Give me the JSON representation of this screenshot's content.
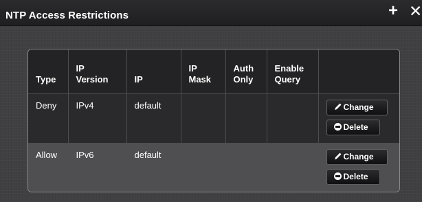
{
  "header": {
    "title": "NTP Access Restrictions",
    "add_glyph": "+",
    "close_glyph": "✕",
    "add_icon": "plus-icon",
    "close_icon": "close-icon"
  },
  "table": {
    "columns": [
      [
        "Type"
      ],
      [
        "IP",
        "Version"
      ],
      [
        "IP"
      ],
      [
        "IP",
        "Mask"
      ],
      [
        "Auth",
        "Only"
      ],
      [
        "Enable",
        "Query"
      ],
      [
        ""
      ]
    ],
    "rows": [
      {
        "type": "Deny",
        "ip_version": "IPv4",
        "ip": "default",
        "ip_mask": "",
        "auth_only": "",
        "enable_query": "",
        "change_label": "Change",
        "delete_label": "Delete"
      },
      {
        "type": "Allow",
        "ip_version": "IPv6",
        "ip": "default",
        "ip_mask": "",
        "auth_only": "",
        "enable_query": "",
        "change_label": "Change",
        "delete_label": "Delete"
      }
    ]
  },
  "colors": {
    "panel_bg": "#404042",
    "header_bg": "#1f1f21",
    "row_dark": "#2a2a2c",
    "row_light": "#4f4f51",
    "text": "#ffffff"
  }
}
